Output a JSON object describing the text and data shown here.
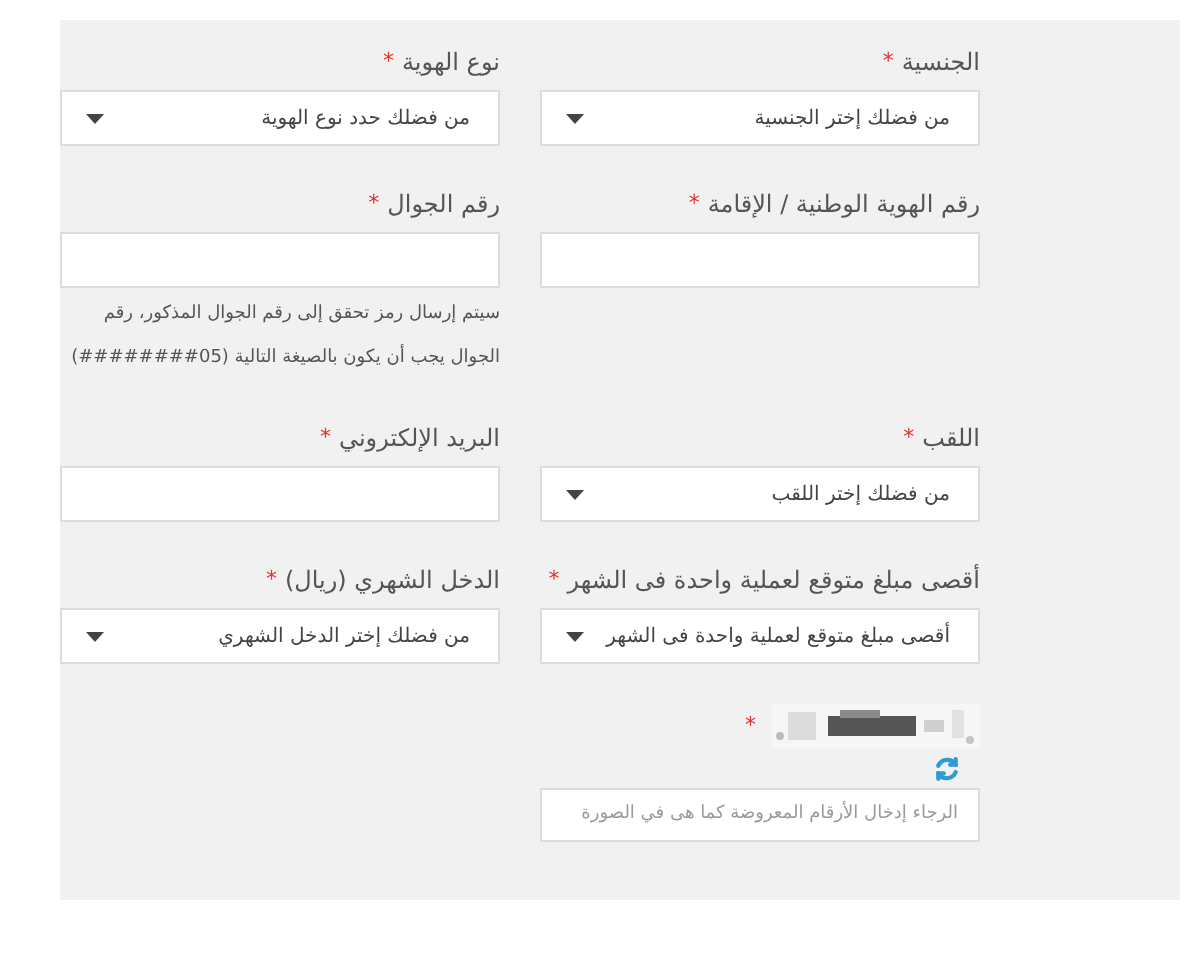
{
  "fields": [
    {
      "kind": "select",
      "label": "الجنسية",
      "required_mark": "*",
      "placeholder": "من فضلك إختر الجنسية"
    },
    {
      "kind": "select",
      "label": "نوع الهوية",
      "required_mark": "*",
      "placeholder": "من فضلك حدد نوع الهوية"
    },
    {
      "kind": "input",
      "label": "رقم الهوية الوطنية / الإقامة",
      "required_mark": "*"
    },
    {
      "kind": "input",
      "label": "رقم الجوال",
      "required_mark": "*",
      "hint": "سيتم إرسال رمز تحقق إلى رقم الجوال المذكور، رقم الجوال يجب أن يكون بالصيغة التالية (05########)"
    },
    {
      "kind": "select",
      "label": "اللقب",
      "required_mark": "*",
      "placeholder": "من فضلك إختر اللقب"
    },
    {
      "kind": "input",
      "label": "البريد الإلكتروني",
      "required_mark": "*"
    },
    {
      "kind": "select",
      "label": "أقصى مبلغ متوقع لعملية واحدة فى الشهر",
      "required_mark": "*",
      "placeholder": "أقصى مبلغ متوقع لعملية واحدة فى الشهر"
    },
    {
      "kind": "select",
      "label": "الدخل الشهري (ريال)",
      "required_mark": "*",
      "placeholder": "من فضلك إختر الدخل الشهري"
    },
    {
      "kind": "captcha",
      "required_mark": "*",
      "placeholder": "الرجاء إدخال الأرقام المعروضة كما هى في الصورة"
    }
  ]
}
